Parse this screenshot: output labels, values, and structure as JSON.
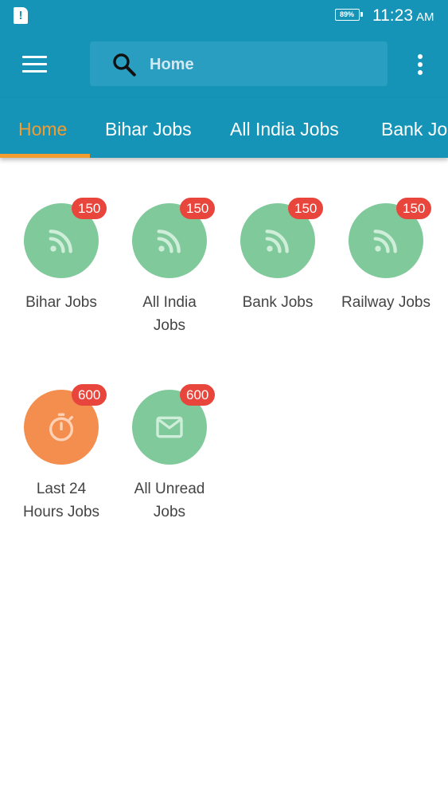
{
  "status_bar": {
    "notification_icon": "sim-alert-icon",
    "notification_glyph": "!",
    "battery_percent": "89%",
    "time": "11:23",
    "ampm": "AM"
  },
  "app_bar": {
    "menu_icon": "hamburger-menu-icon",
    "search_icon": "search-icon",
    "search_text": "Home",
    "overflow_icon": "overflow-menu-icon"
  },
  "tabs": [
    {
      "label": "Home",
      "active": true
    },
    {
      "label": "Bihar Jobs",
      "active": false
    },
    {
      "label": "All India Jobs",
      "active": false
    },
    {
      "label": "Bank Jobs",
      "active": false
    }
  ],
  "categories": [
    {
      "label": "Bihar Jobs",
      "count": "150",
      "icon": "rss-feed-icon",
      "color": "#80c99b"
    },
    {
      "label": "All India Jobs",
      "count": "150",
      "icon": "rss-feed-icon",
      "color": "#80c99b"
    },
    {
      "label": "Bank Jobs",
      "count": "150",
      "icon": "rss-feed-icon",
      "color": "#80c99b"
    },
    {
      "label": "Railway Jobs",
      "count": "150",
      "icon": "rss-feed-icon",
      "color": "#80c99b"
    },
    {
      "label": "Last 24 Hours Jobs",
      "count": "600",
      "icon": "stopwatch-icon",
      "color": "#f48e4f"
    },
    {
      "label": "All Unread Jobs",
      "count": "600",
      "icon": "mail-icon",
      "color": "#80c99b"
    }
  ],
  "colors": {
    "primary": "#1694b8",
    "accent": "#f39c2f",
    "badge": "#e8453c"
  }
}
